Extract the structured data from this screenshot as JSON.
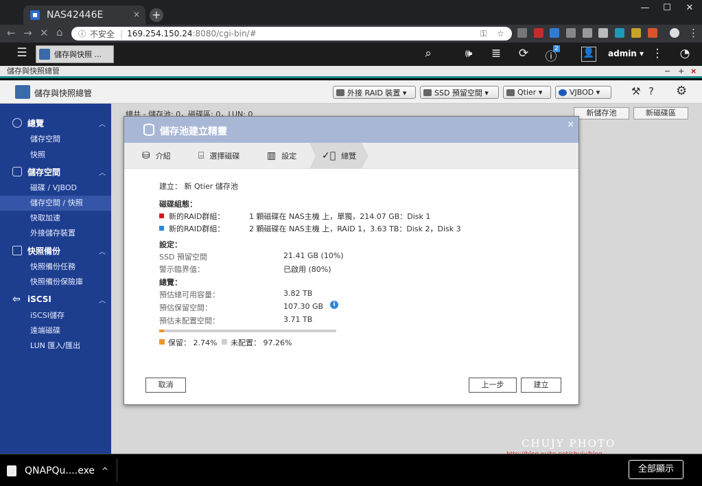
{
  "browser": {
    "tab_title": "NAS42446E",
    "tab_close": "×",
    "new_tab": "+",
    "window_controls": [
      "—",
      "☐",
      "✕"
    ],
    "security_label": "不安全",
    "url_host": "169.254.150.24",
    "url_rest": ":8080/cgi-bin/#"
  },
  "qts": {
    "app_tab_label": "儲存與快照 ...",
    "user": "admin ▾",
    "notification_count": "2"
  },
  "window": {
    "title": "儲存與快照總管",
    "controls": [
      "−",
      "+",
      "×"
    ]
  },
  "app_header": {
    "title": "儲存與快照總管",
    "buttons": [
      "外接 RAID 裝置 ▾",
      "SSD 預留空間 ▾",
      "Qtier ▾",
      "VJBOD ▾"
    ]
  },
  "sidebar": {
    "groups": [
      {
        "label": "總覽",
        "items": [
          "儲存空間",
          "快照"
        ]
      },
      {
        "label": "儲存空間",
        "items": [
          "磁碟 / VJBOD",
          "儲存空間 / 快照",
          "快取加速",
          "外接儲存裝置"
        ]
      },
      {
        "label": "快照備份",
        "items": [
          "快照備份任務",
          "快照備份保險庫"
        ]
      },
      {
        "label": "iSCSI",
        "items": [
          "iSCSI儲存",
          "遠端磁碟",
          "LUN 匯入/匯出"
        ]
      }
    ],
    "active_item": "儲存空間 / 快照"
  },
  "main": {
    "stats": "總共 - 儲存池: 0，磁碟區: 0，LUN: 0",
    "new_pool_button": "新儲存池",
    "new_volume_button": "新磁碟區"
  },
  "dialog": {
    "title": "儲存池建立精靈",
    "close": "×",
    "steps": [
      "介紹",
      "選擇磁碟",
      "設定",
      "總覽"
    ],
    "create_line": "建立： 新 Qtier 儲存池",
    "disk_config_heading": "磁碟組態：",
    "raid_groups": [
      {
        "label": "新的RAID群組：",
        "desc": "1 顆磁碟在 NAS主機 上，單獨，214.07 GB：Disk 1",
        "color": "#d9181c"
      },
      {
        "label": "新的RAID群組：",
        "desc": "2 顆磁碟在 NAS主機 上，RAID 1，3.63 TB：Disk 2，Disk 3",
        "color": "#2f86d8"
      }
    ],
    "settings_heading": "設定：",
    "settings": [
      {
        "label": "SSD 預留空間",
        "value": "21.41 GB (10%)"
      },
      {
        "label": "警示臨界值：",
        "value": "已啟用 (80%)"
      }
    ],
    "overview_heading": "總覽：",
    "overview": [
      {
        "label": "預估總可用容量：",
        "value": "3.82 TB"
      },
      {
        "label": "預估保留空間：",
        "value": "107.30 GB"
      },
      {
        "label": "預估未配置空間：",
        "value": "3.71 TB"
      }
    ],
    "info_icon": "i",
    "reserved_fraction": 0.0274,
    "reserved_color": "#f0962e",
    "unallocated_color": "#cfcfcf",
    "legend_reserved": "保留： 2.74%",
    "legend_unallocated": "未配置： 97.26%",
    "cancel_button": "取消",
    "back_button": "上一步",
    "create_button": "建立"
  },
  "download_bar": {
    "file_name": "QNAPQu....exe",
    "chevron": "^",
    "show_all": "全部顯示"
  },
  "watermark": {
    "title": "CHUJY PHOTO",
    "url": "http://blog.xuite.net/chujy/blog"
  }
}
